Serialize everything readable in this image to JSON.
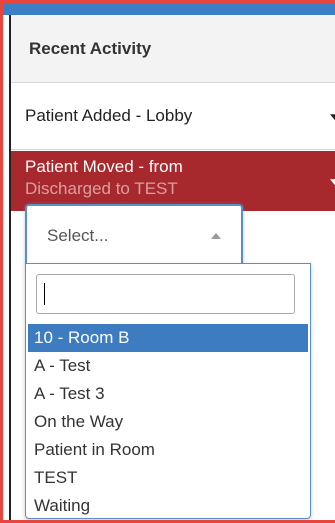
{
  "panel": {
    "title": "Recent Activity"
  },
  "activities": [
    {
      "label": "Patient Added - Lobby"
    },
    {
      "line1": "Patient Moved - from",
      "line2": "Discharged to TEST"
    }
  ],
  "select": {
    "placeholder": "Select...",
    "search_value": "",
    "options": [
      {
        "label": "10 - Room B",
        "highlighted": true
      },
      {
        "label": "A - Test"
      },
      {
        "label": "A - Test 3"
      },
      {
        "label": "On the Way"
      },
      {
        "label": "Patient in Room"
      },
      {
        "label": "TEST"
      },
      {
        "label": "Waiting"
      }
    ]
  },
  "colors": {
    "accent_red": "#a8292d",
    "highlight_blue": "#3d7cc0",
    "focus_border": "#5b8fc8"
  }
}
